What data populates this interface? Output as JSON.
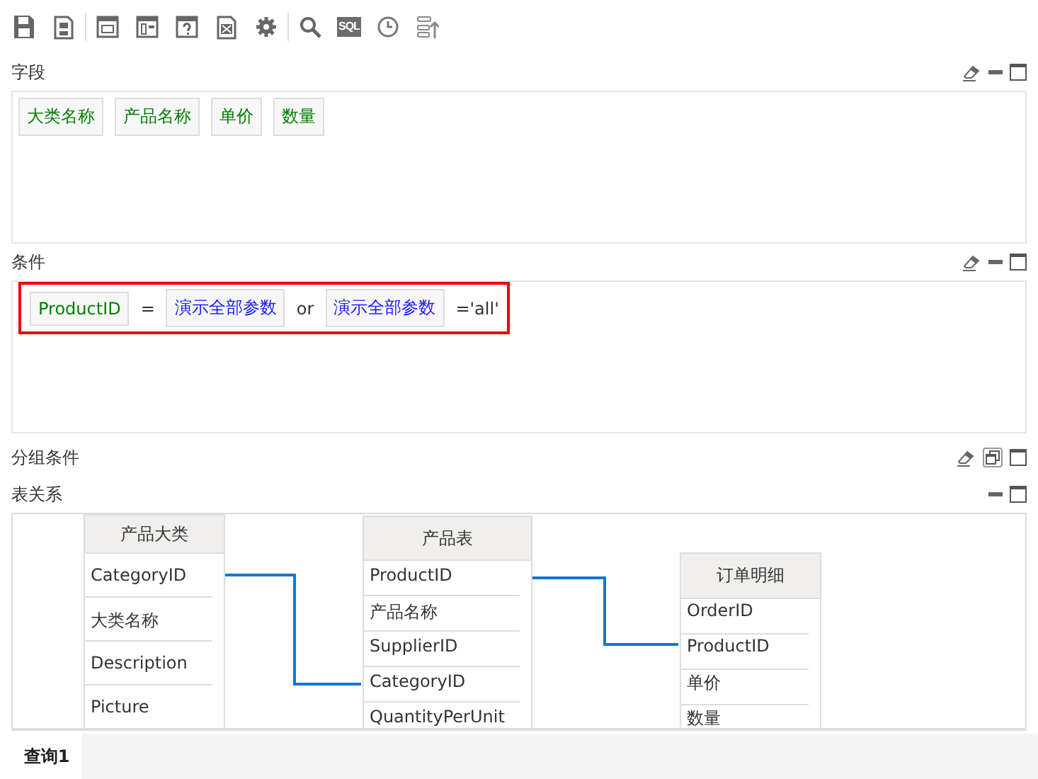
{
  "toolbar": [
    [
      {
        "kind": "save"
      },
      {
        "kind": "save-as"
      }
    ],
    [
      {
        "kind": "layout-top"
      },
      {
        "kind": "layout-side"
      },
      {
        "kind": "help-form"
      },
      {
        "kind": "export"
      },
      {
        "kind": "settings"
      }
    ],
    [
      {
        "kind": "search"
      },
      {
        "kind": "sql",
        "label": "SQL"
      },
      {
        "kind": "clock"
      },
      {
        "kind": "sort"
      }
    ]
  ],
  "fields": {
    "title": "字段",
    "controls": [
      {
        "kind": "eraser"
      },
      {
        "kind": "minimize"
      },
      {
        "kind": "maximize"
      }
    ],
    "chips": [
      "大类名称",
      "产品名称",
      "单价",
      "数量"
    ]
  },
  "conditions": {
    "title": "条件",
    "controls": [
      {
        "kind": "eraser"
      },
      {
        "kind": "minimize"
      },
      {
        "kind": "maximize"
      }
    ],
    "highlighted": true,
    "tokens": [
      {
        "kind": "field",
        "text": "ProductID"
      },
      {
        "kind": "operator",
        "text": "="
      },
      {
        "kind": "param",
        "text": "演示全部参数"
      },
      {
        "kind": "operator",
        "text": "or"
      },
      {
        "kind": "param",
        "text": "演示全部参数"
      },
      {
        "kind": "operator",
        "text": "='all'"
      }
    ]
  },
  "grouping": {
    "title": "分组条件",
    "controls": [
      {
        "kind": "eraser"
      },
      {
        "kind": "restore"
      },
      {
        "kind": "maximize"
      }
    ]
  },
  "relations": {
    "title": "表关系",
    "controls": [
      {
        "kind": "minimize"
      },
      {
        "kind": "maximize"
      }
    ],
    "tables": [
      {
        "title": "产品大类",
        "columns": [
          "CategoryID",
          "大类名称",
          "Description",
          "Picture"
        ]
      },
      {
        "title": "产品表",
        "columns": [
          "ProductID",
          "产品名称",
          "SupplierID",
          "CategoryID",
          "QuantityPerUnit"
        ]
      },
      {
        "title": "订单明细",
        "columns": [
          "OrderID",
          "ProductID",
          "单价",
          "数量"
        ]
      }
    ]
  },
  "tabs": [
    {
      "label": "查询1",
      "selected": true
    }
  ]
}
